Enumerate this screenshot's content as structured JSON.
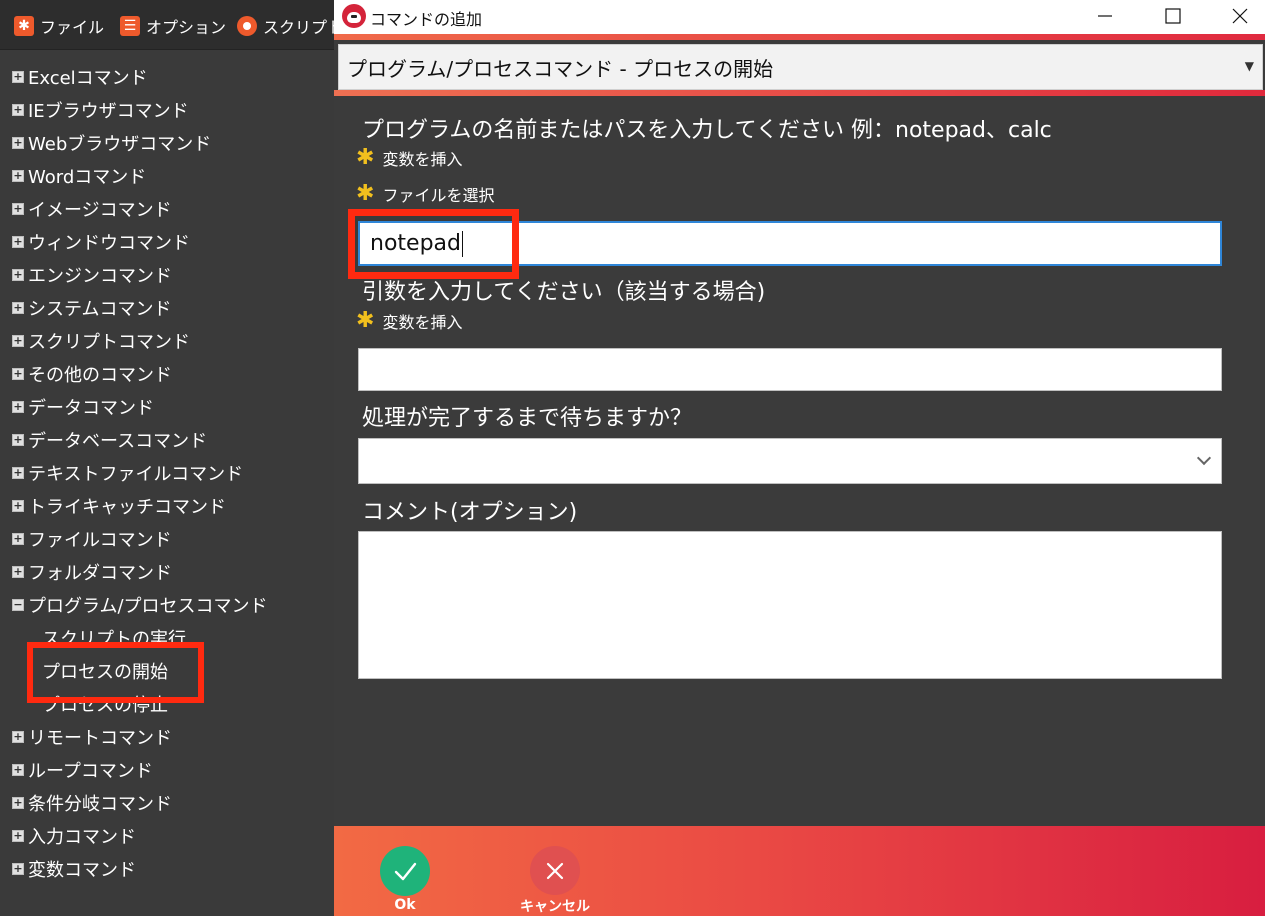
{
  "menubar": {
    "items": [
      "ファイル",
      "オプション",
      "スクリプト"
    ]
  },
  "tree": {
    "categories": [
      "Excelコマンド",
      "IEブラウザコマンド",
      "Webブラウザコマンド",
      "Wordコマンド",
      "イメージコマンド",
      "ウィンドウコマンド",
      "エンジンコマンド",
      "システムコマンド",
      "スクリプトコマンド",
      "その他のコマンド",
      "データコマンド",
      "データベースコマンド",
      "テキストファイルコマンド",
      "トライキャッチコマンド",
      "ファイルコマンド",
      "フォルダコマンド",
      "プログラム/プロセスコマンド",
      "リモートコマンド",
      "ループコマンド",
      "条件分岐コマンド",
      "入力コマンド",
      "変数コマンド"
    ],
    "expanded_children": [
      "スクリプトの実行",
      "プロセスの開始",
      "プロセスの停止"
    ],
    "selected_child": "プロセスの開始"
  },
  "dialog": {
    "title": "コマンドの追加",
    "command_selection": "プログラム/プロセスコマンド - プロセスの開始",
    "program_label": "プログラムの名前またはパスを入力してください 例：notepad、calc",
    "insert_variable": "変数を挿入",
    "select_file": "ファイルを選択",
    "program_value": "notepad",
    "arguments_label": "引数を入力してください（該当する場合)",
    "arguments_insert_variable": "変数を挿入",
    "arguments_value": "",
    "wait_label": "処理が完了するまで待ちますか？",
    "wait_value": "",
    "comment_label": "コメント(オプション)",
    "comment_value": "",
    "ok_label": "Ok",
    "cancel_label": "キャンセル"
  },
  "colors": {
    "accent_start": "#f26a44",
    "accent_end": "#d81e40",
    "ok_green": "#1fb37a",
    "cancel_red": "#e05050",
    "highlight_red": "#ff2a10",
    "star_yellow": "#f2c01e"
  }
}
